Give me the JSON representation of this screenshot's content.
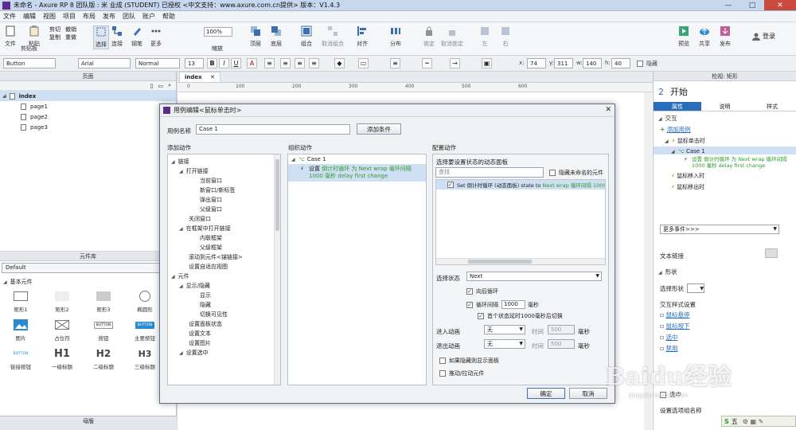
{
  "window": {
    "title": "未命名 - Axure RP 8 团队版 : 米 业成 (STUDENT) 已授权    <中文支持：www.axure.com.cn提供> 版本：V1.4.3",
    "minimize": "—",
    "maximize": "□",
    "close": "✕"
  },
  "menu": [
    "文件",
    "编辑",
    "视图",
    "项目",
    "布局",
    "发布",
    "团队",
    "账户",
    "帮助"
  ],
  "toolbar": {
    "file": "文件",
    "clipboard": "剪贴板",
    "cut": "剪切",
    "copy": "复制",
    "paste": "粘贴",
    "undo": "撤销",
    "redo": "重做",
    "select": "选择",
    "connect": "连接",
    "pen": "钢笔",
    "more": "更多",
    "zoom_value": "100%",
    "zoom_label": "缩放",
    "top": "顶层",
    "bottom": "底层",
    "group": "组合",
    "ungroup": "取消组合",
    "align": "对齐",
    "distribute": "分布",
    "lock": "锁定",
    "unlock": "取消锁定",
    "left": "左",
    "right": "右",
    "preview": "预览",
    "share": "共享",
    "publish": "发布",
    "login": "登录"
  },
  "formatbar": {
    "widget_type": "Button",
    "font": "Arial",
    "style": "Normal",
    "size": "13",
    "bold": "B",
    "italic": "I",
    "underline": "U",
    "x_label": "x:",
    "x": "74",
    "y_label": "y:",
    "y": "311",
    "w_label": "w:",
    "w": "140",
    "h_label": "h:",
    "h": "40",
    "hidden": "隐藏"
  },
  "pages_panel": {
    "title": "页面",
    "root": "index",
    "children": [
      "page1",
      "page2",
      "page3"
    ]
  },
  "library_panel": {
    "title": "元件库",
    "selected": "Default",
    "group": "基本元件",
    "items": [
      "矩形1",
      "矩形2",
      "矩形3",
      "椭圆形",
      "图片",
      "占位符",
      "按钮",
      "主要按钮",
      "链接按钮",
      "一级标题",
      "二级标题",
      "三级标题"
    ],
    "button_text": "BUTTON",
    "h1": "H1",
    "h2": "H2",
    "h3": "H3"
  },
  "master_panel": {
    "title": "母版"
  },
  "canvas": {
    "tab": "index",
    "ruler_ticks": [
      "0",
      "100",
      "200",
      "300",
      "400",
      "500",
      "600"
    ]
  },
  "right_panel": {
    "header": "检视: 矩形",
    "number": "2",
    "name": "开始",
    "tabs": [
      "属性",
      "说明",
      "样式"
    ],
    "interaction": "交互",
    "add_case": "添加用例",
    "on_click": "鼠标单击时",
    "case": "Case 1",
    "action": "设置 倒计时循环 为 Next wrap 循环间隔 1000 毫秒 delay first change",
    "mouse_enter": "鼠标移入时",
    "mouse_leave": "鼠标移出时",
    "more_events": "更多事件>>>",
    "text_link": "文本链接",
    "shape": "形状",
    "select_shape": "选择形状",
    "interaction_style": "交互样式设置",
    "hover": "鼠标悬停",
    "mousedown": "鼠标按下",
    "selected": "选中",
    "disabled": "禁用",
    "checked": "选中",
    "set_group": "设置选项组名称"
  },
  "dialog": {
    "title": "用例编辑<鼠标单击时>",
    "case_name_label": "用例名称",
    "case_name_value": "Case 1",
    "add_condition": "添加条件",
    "add_action_title": "添加动作",
    "organize_title": "组织动作",
    "configure_title": "配置动作",
    "action_tree": [
      {
        "level": 0,
        "text": "链接",
        "arrow": "◢"
      },
      {
        "level": 1,
        "text": "打开链接",
        "arrow": "◢"
      },
      {
        "level": 3,
        "text": "当前窗口"
      },
      {
        "level": 3,
        "text": "新窗口/新标签"
      },
      {
        "level": 3,
        "text": "弹出窗口"
      },
      {
        "level": 3,
        "text": "父级窗口"
      },
      {
        "level": 2,
        "text": "关闭窗口"
      },
      {
        "level": 1,
        "text": "在框架中打开链接",
        "arrow": "◢"
      },
      {
        "level": 3,
        "text": "内联框架"
      },
      {
        "level": 3,
        "text": "父级框架"
      },
      {
        "level": 2,
        "text": "滚动到元件<锚链接>"
      },
      {
        "level": 2,
        "text": "设置自适应视图"
      },
      {
        "level": 0,
        "text": "元件",
        "arrow": "◢"
      },
      {
        "level": 1,
        "text": "显示/隐藏",
        "arrow": "◢"
      },
      {
        "level": 3,
        "text": "显示"
      },
      {
        "level": 3,
        "text": "隐藏"
      },
      {
        "level": 3,
        "text": "切换可见性"
      },
      {
        "level": 2,
        "text": "设置面板状态"
      },
      {
        "level": 2,
        "text": "设置文本"
      },
      {
        "level": 2,
        "text": "设置图片"
      },
      {
        "level": 1,
        "text": "设置选中",
        "arrow": "◢"
      }
    ],
    "org_case": "Case 1",
    "org_action_prefix": "设置",
    "org_action_green": "倒计时循环 为 Next wrap 循环间隔",
    "org_action_green2": "1000 毫秒 delay first change",
    "config": {
      "panel_label": "选择要设置状态的动态面板",
      "search_placeholder": "查找",
      "hide_unnamed": "隐藏未命名的元件",
      "item_prefix": "Set 倒计时循环 (动态面板) state to",
      "item_green": "Next wrap 循环间隔 1000",
      "select_state_label": "选择状态",
      "state_value": "Next",
      "wrap": "向后循环",
      "interval": "循环间隔",
      "interval_value": "1000",
      "ms": "毫秒",
      "first_delay": "首个状态延时1000毫秒后切换",
      "enter_anim": "进入动画",
      "exit_anim": "退出动画",
      "anim_none": "无",
      "time_label": "时间",
      "time_value": "500",
      "show_if_hidden": "如果隐藏则显示面板",
      "push_pull": "推动/拉动元件"
    },
    "ok": "确定",
    "cancel": "取消"
  },
  "watermark": {
    "brand": "Baidu经验",
    "url": "jingyan.baidu.com"
  },
  "ime": {
    "text": "五"
  }
}
